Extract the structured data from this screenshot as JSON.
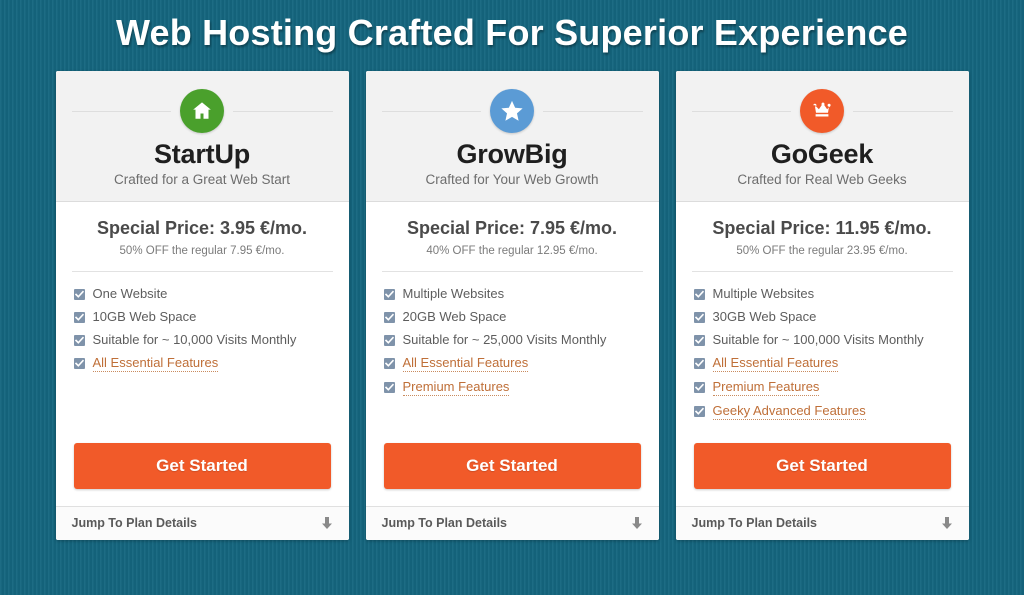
{
  "header": {
    "title": "Web Hosting Crafted For Superior Experience"
  },
  "colors": {
    "background": "#156780",
    "cta": "#f15a29",
    "link": "#bf6f38",
    "checkbox": "#7f93aa",
    "icon_startup": "#4aa02c",
    "icon_growbig": "#5b9bd5",
    "icon_gogeek": "#f15a29"
  },
  "footer_labels": {
    "jump_to_details": "Jump To Plan Details",
    "arrow_icon": "arrow-down-icon"
  },
  "cta_label": "Get Started",
  "plans": [
    {
      "id": "startup",
      "icon": "home-icon",
      "icon_color": "#4aa02c",
      "name": "StartUp",
      "tagline": "Crafted for a Great Web Start",
      "price_main": "Special Price: 3.95 €/mo.",
      "price_sub": "50% OFF the regular 7.95 €/mo.",
      "features": [
        {
          "text": "One Website",
          "link": false
        },
        {
          "text": "10GB Web Space",
          "link": false
        },
        {
          "text": "Suitable for ~ 10,000 Visits Monthly",
          "link": false
        },
        {
          "text": "All Essential Features",
          "link": true
        }
      ],
      "cta": "Get Started",
      "footer": "Jump To Plan Details"
    },
    {
      "id": "growbig",
      "icon": "star-icon",
      "icon_color": "#5b9bd5",
      "name": "GrowBig",
      "tagline": "Crafted for Your Web Growth",
      "price_main": "Special Price: 7.95 €/mo.",
      "price_sub": "40% OFF the regular 12.95 €/mo.",
      "features": [
        {
          "text": "Multiple Websites",
          "link": false
        },
        {
          "text": "20GB Web Space",
          "link": false
        },
        {
          "text": "Suitable for ~ 25,000 Visits Monthly",
          "link": false
        },
        {
          "text": "All Essential Features",
          "link": true
        },
        {
          "text": "Premium Features",
          "link": true
        }
      ],
      "cta": "Get Started",
      "footer": "Jump To Plan Details"
    },
    {
      "id": "gogeek",
      "icon": "crown-icon",
      "icon_color": "#f15a29",
      "name": "GoGeek",
      "tagline": "Crafted for Real Web Geeks",
      "price_main": "Special Price: 11.95 €/mo.",
      "price_sub": "50% OFF the regular 23.95 €/mo.",
      "features": [
        {
          "text": "Multiple Websites",
          "link": false
        },
        {
          "text": "30GB Web Space",
          "link": false
        },
        {
          "text": "Suitable for ~ 100,000 Visits Monthly",
          "link": false
        },
        {
          "text": "All Essential Features",
          "link": true
        },
        {
          "text": "Premium Features",
          "link": true
        },
        {
          "text": "Geeky Advanced Features",
          "link": true
        }
      ],
      "cta": "Get Started",
      "footer": "Jump To Plan Details"
    }
  ]
}
